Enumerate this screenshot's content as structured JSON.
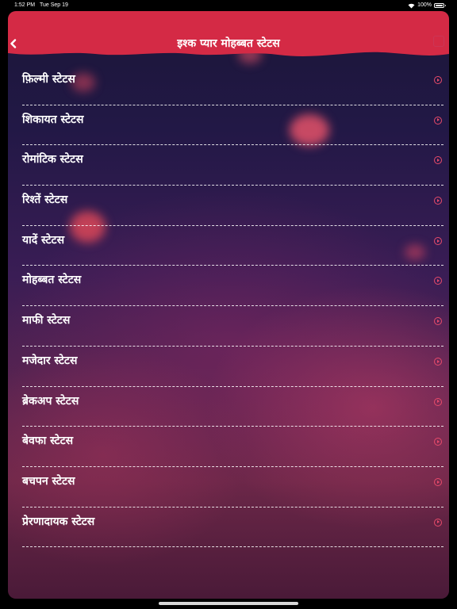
{
  "status_bar": {
    "time": "1:52 PM",
    "date": "Tue Sep 19",
    "battery": "100%"
  },
  "header": {
    "title": "इश्क प्यार मोहब्बत स्टेटस",
    "back_icon": "chevron-left-icon"
  },
  "colors": {
    "header": "#d42a45",
    "accent": "#e84a6a"
  },
  "items": [
    {
      "label": "फ़िल्मी स्टेटस"
    },
    {
      "label": "शिकायत स्टेटस"
    },
    {
      "label": "रोमांटिक स्टेटस"
    },
    {
      "label": "रिश्तें स्टेटस"
    },
    {
      "label": "यादें स्टेटस"
    },
    {
      "label": "मोहब्बत स्टेटस"
    },
    {
      "label": "माफी स्टेटस"
    },
    {
      "label": "मजेदार स्टेटस"
    },
    {
      "label": "ब्रेकअप स्टेटस"
    },
    {
      "label": "बेवफा स्टेटस"
    },
    {
      "label": "बचपन स्टेटस"
    },
    {
      "label": "प्रेरणादायक स्टेटस"
    }
  ]
}
